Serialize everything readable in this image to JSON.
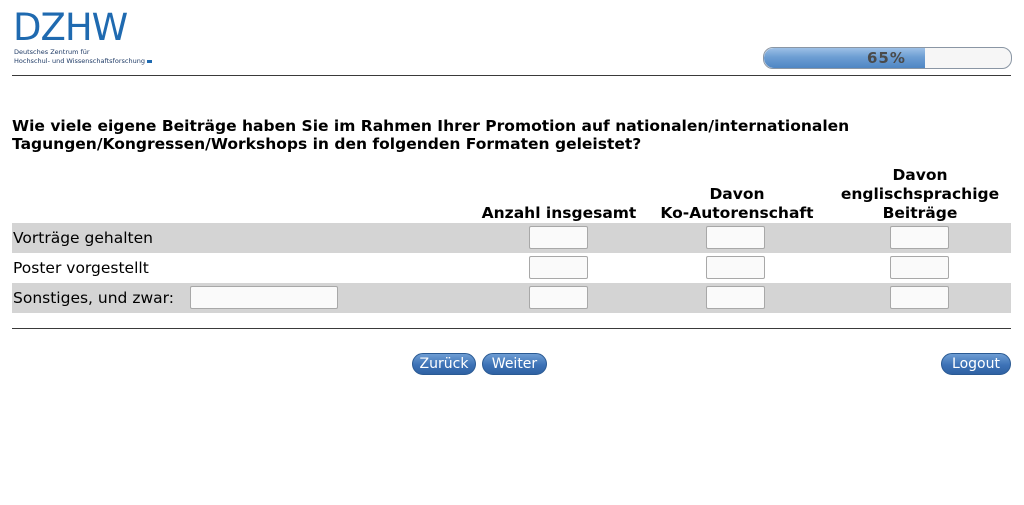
{
  "logo": {
    "wordmark": "DZHW",
    "subtitle_line1": "Deutsches Zentrum für",
    "subtitle_line2": "Hochschul- und Wissenschaftsforschung"
  },
  "progress": {
    "percent": 65,
    "label": "65%"
  },
  "question": "Wie viele eigene Beiträge haben Sie im Rahmen Ihrer Promotion auf nationalen/internationalen Tagungen/Kongressen/Workshops in den folgenden Formaten geleistet?",
  "columns": {
    "total": "Anzahl insgesamt",
    "coauthor_line1": "Davon",
    "coauthor_line2": "Ko-Autorenschaft",
    "english_line1": "Davon",
    "english_line2": "englischsprachige",
    "english_line3": "Beiträge"
  },
  "rows": [
    {
      "label": "Vorträge gehalten"
    },
    {
      "label": "Poster vorgestellt"
    },
    {
      "label": "Sonstiges, und zwar:",
      "other_value": ""
    }
  ],
  "buttons": {
    "back": "Zurück",
    "next": "Weiter",
    "logout": "Logout"
  },
  "colors": {
    "brand": "#1f6ab0",
    "button": "#3d72b6",
    "row_shade": "#d4d4d4"
  }
}
